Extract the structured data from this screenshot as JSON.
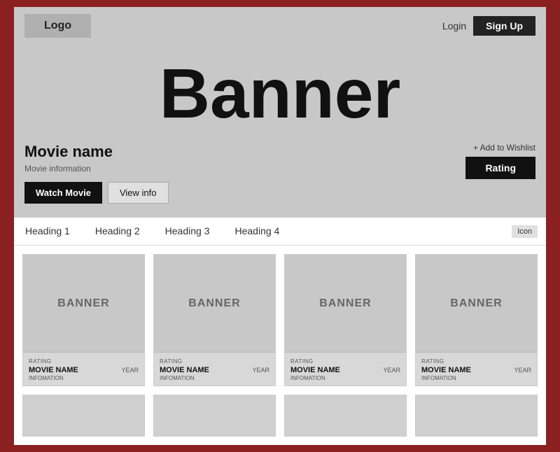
{
  "header": {
    "logo_label": "Logo",
    "login_label": "Login",
    "signup_label": "Sign Up"
  },
  "banner": {
    "title": "Banner"
  },
  "movie": {
    "name": "Movie name",
    "information": "Movie information",
    "watch_btn": "Watch Movie",
    "view_info_btn": "View info",
    "add_wishlist": "+ Add to Wishlist",
    "rating_btn": "Rating"
  },
  "nav": {
    "tabs": [
      {
        "label": "Heading 1"
      },
      {
        "label": "Heading 2"
      },
      {
        "label": "Heading 3"
      },
      {
        "label": "Heading 4"
      }
    ],
    "icon_btn": "Icon"
  },
  "movie_cards": [
    {
      "banner": "BANNER",
      "rating_label": "RATING",
      "movie_name": "MOVIE NAME",
      "info": "INFOMATION",
      "year": "YEAR"
    },
    {
      "banner": "BANNER",
      "rating_label": "RATING",
      "movie_name": "MOVIE NAME",
      "info": "INFOMATION",
      "year": "YEAR"
    },
    {
      "banner": "BANNER",
      "rating_label": "RATING",
      "movie_name": "MOVIE NAME",
      "info": "INFOMATION",
      "year": "YEAR"
    },
    {
      "banner": "BANNER",
      "rating_label": "RATING",
      "movie_name": "MOVIE NAME",
      "info": "INFOMATION",
      "year": "YEAR"
    }
  ]
}
